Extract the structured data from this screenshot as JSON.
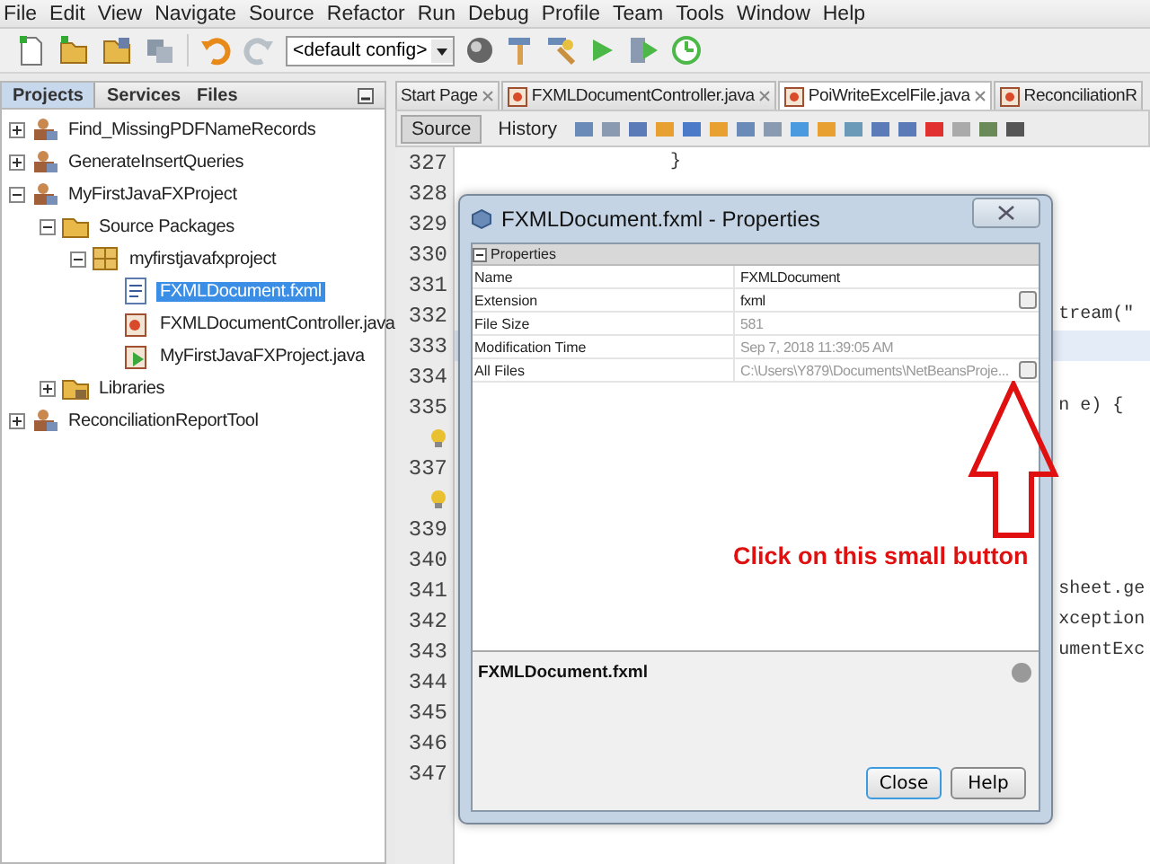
{
  "menu": [
    "File",
    "Edit",
    "View",
    "Navigate",
    "Source",
    "Refactor",
    "Run",
    "Debug",
    "Profile",
    "Team",
    "Tools",
    "Window",
    "Help"
  ],
  "toolbar": {
    "config": "<default config>"
  },
  "projects": {
    "tabs": [
      {
        "label": "Projects",
        "selected": true
      },
      {
        "label": "Services",
        "selected": false
      },
      {
        "label": "Files",
        "selected": false
      }
    ],
    "tree": [
      {
        "label": "Find_MissingPDFNameRecords",
        "kind": "project",
        "expanded": false,
        "selected": false
      },
      {
        "label": "GenerateInsertQueries",
        "kind": "project",
        "expanded": false,
        "selected": false
      },
      {
        "label": "MyFirstJavaFXProject",
        "kind": "project",
        "expanded": true,
        "selected": false,
        "children": [
          {
            "label": "Source Packages",
            "kind": "folder",
            "expanded": true,
            "selected": false,
            "children": [
              {
                "label": "myfirstjavafxproject",
                "kind": "package",
                "expanded": true,
                "selected": false,
                "children": [
                  {
                    "label": "FXMLDocument.fxml",
                    "kind": "fxml",
                    "selected": true
                  },
                  {
                    "label": "FXMLDocumentController.java",
                    "kind": "java",
                    "selected": false
                  },
                  {
                    "label": "MyFirstJavaFXProject.java",
                    "kind": "main",
                    "selected": false
                  }
                ]
              }
            ]
          },
          {
            "label": "Libraries",
            "kind": "library",
            "expanded": false,
            "selected": false
          }
        ]
      },
      {
        "label": "ReconciliationReportTool",
        "kind": "project",
        "expanded": false,
        "selected": false
      }
    ]
  },
  "editor": {
    "tabs": [
      {
        "label": "Start Page",
        "selected": false
      },
      {
        "label": "FXMLDocumentController.java",
        "selected": false
      },
      {
        "label": "PoiWriteExcelFile.java",
        "selected": true
      },
      {
        "label": "ReconciliationR",
        "selected": false
      }
    ],
    "views": [
      {
        "label": "Source",
        "selected": true
      },
      {
        "label": "History",
        "selected": false
      }
    ],
    "lines": [
      {
        "kind": "number",
        "number": "327",
        "code": "                    }",
        "highlighted": false
      },
      {
        "kind": "number",
        "number": "328",
        "highlighted": false
      },
      {
        "kind": "number",
        "number": "329",
        "highlighted": false
      },
      {
        "kind": "number",
        "number": "330",
        "highlighted": false
      },
      {
        "kind": "number",
        "number": "331",
        "highlighted": false
      },
      {
        "kind": "number",
        "number": "332",
        "code": "                                                        tream(\"",
        "highlighted": false
      },
      {
        "kind": "number",
        "number": "333",
        "highlighted": true
      },
      {
        "kind": "number",
        "number": "334",
        "highlighted": false
      },
      {
        "kind": "number",
        "number": "335",
        "code": "                                                        n e) {",
        "highlighted": false
      },
      {
        "kind": "hint",
        "highlighted": false
      },
      {
        "kind": "number",
        "number": "337",
        "highlighted": false
      },
      {
        "kind": "hint",
        "highlighted": false
      },
      {
        "kind": "number",
        "number": "339",
        "highlighted": false
      },
      {
        "kind": "number",
        "number": "340",
        "highlighted": false
      },
      {
        "kind": "number",
        "number": "341",
        "code": "                                                        sheet.ge",
        "highlighted": false
      },
      {
        "kind": "number",
        "number": "342",
        "code": "                                                        xception",
        "highlighted": false
      },
      {
        "kind": "number",
        "number": "343",
        "code": "                                                        umentExc",
        "highlighted": false
      },
      {
        "kind": "number",
        "number": "344",
        "highlighted": false
      },
      {
        "kind": "number",
        "number": "345",
        "highlighted": false
      },
      {
        "kind": "number",
        "number": "346",
        "highlighted": false
      },
      {
        "kind": "number",
        "number": "347",
        "highlighted": false
      }
    ]
  },
  "dialog": {
    "title": "FXMLDocument.fxml - Properties",
    "section": "Properties",
    "rows": [
      {
        "name": "Name",
        "value": "FXMLDocument",
        "read_only": false,
        "has_button": false
      },
      {
        "name": "Extension",
        "value": "fxml",
        "read_only": false,
        "has_button": true
      },
      {
        "name": "File Size",
        "value": "581",
        "read_only": true,
        "has_button": false
      },
      {
        "name": "Modification Time",
        "value": "Sep 7, 2018 11:39:05 AM",
        "read_only": true,
        "has_button": false
      },
      {
        "name": "All Files",
        "value": "C:\\Users\\Y879\\Documents\\NetBeansProje...",
        "read_only": true,
        "has_button": true
      }
    ],
    "description": "FXMLDocument.fxml",
    "buttons": [
      {
        "label": "Close",
        "default": true
      },
      {
        "label": "Help",
        "default": false
      }
    ]
  },
  "annotation": {
    "text": "Click on this small button"
  }
}
